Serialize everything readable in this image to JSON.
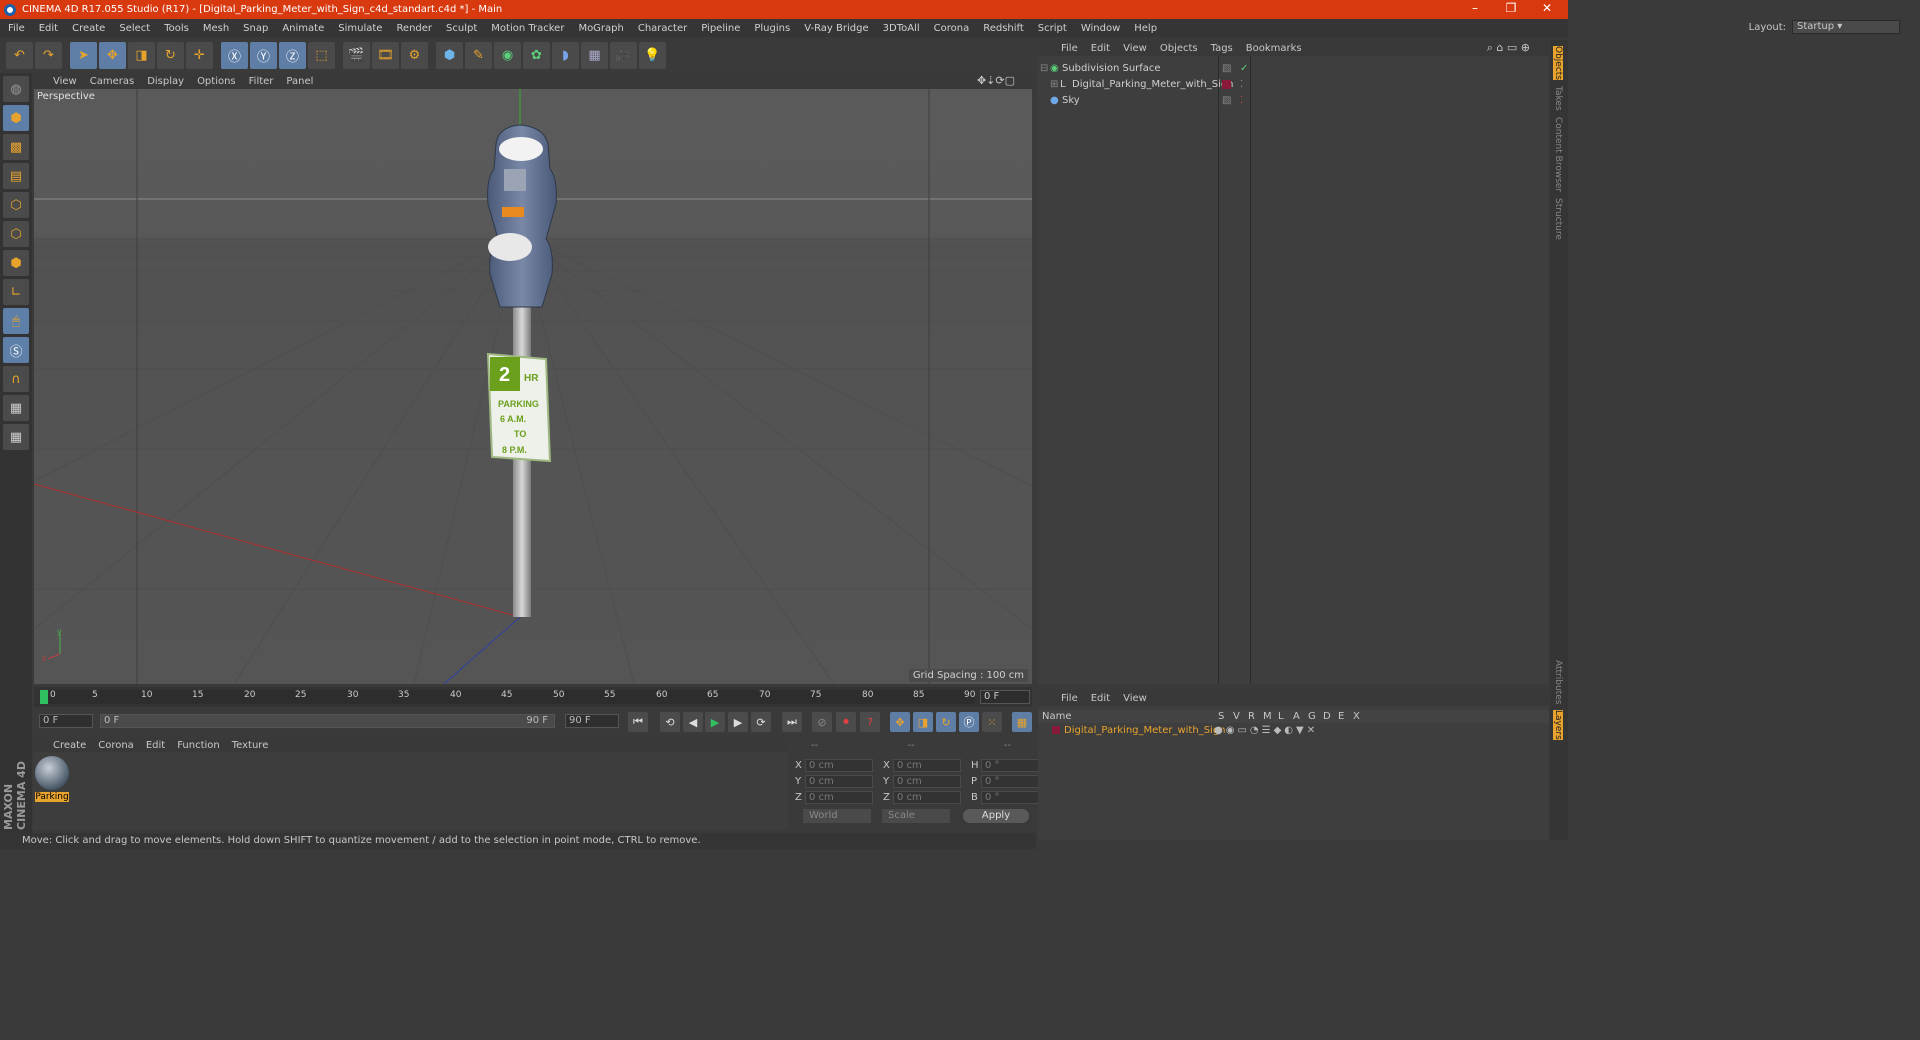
{
  "window": {
    "title": "CINEMA 4D R17.055 Studio (R17) - [Digital_Parking_Meter_with_Sign_c4d_standart.c4d *] - Main"
  },
  "menu": [
    "File",
    "Edit",
    "Create",
    "Select",
    "Tools",
    "Mesh",
    "Snap",
    "Animate",
    "Simulate",
    "Render",
    "Sculpt",
    "Motion Tracker",
    "MoGraph",
    "Character",
    "Pipeline",
    "Plugins",
    "V-Ray Bridge",
    "3DToAll",
    "Corona",
    "Redshift",
    "Script",
    "Window",
    "Help"
  ],
  "layout": {
    "label": "Layout:",
    "value": "Startup"
  },
  "viewport": {
    "menu": [
      "View",
      "Cameras",
      "Display",
      "Options",
      "Filter",
      "Panel"
    ],
    "label": "Perspective",
    "grid_spacing": "Grid Spacing : 100 cm",
    "sign": {
      "number": "2",
      "hr": "HR",
      "l1": "PARKING",
      "l2": "6 A.M.",
      "l3": "TO",
      "l4": "8 P.M."
    }
  },
  "timeline": {
    "ticks": [
      "0",
      "5",
      "10",
      "15",
      "20",
      "25",
      "30",
      "35",
      "40",
      "45",
      "50",
      "55",
      "60",
      "65",
      "70",
      "75",
      "80",
      "85",
      "90"
    ],
    "current": "0 F"
  },
  "playback": {
    "start": "0 F",
    "range_start": "0 F",
    "range_end": "90 F",
    "end": "90 F"
  },
  "materials": {
    "menu": [
      "Create",
      "Corona",
      "Edit",
      "Function",
      "Texture"
    ],
    "items": [
      {
        "name": "Parking"
      }
    ]
  },
  "coordinates": {
    "header": [
      "--",
      "--",
      "--"
    ],
    "rows": [
      {
        "a": "X",
        "av": "0 cm",
        "b": "X",
        "bv": "0 cm",
        "c": "H",
        "cv": "0 °"
      },
      {
        "a": "Y",
        "av": "0 cm",
        "b": "Y",
        "bv": "0 cm",
        "c": "P",
        "cv": "0 °"
      },
      {
        "a": "Z",
        "av": "0 cm",
        "b": "Z",
        "bv": "0 cm",
        "c": "B",
        "cv": "0 °"
      }
    ],
    "mode1": "World",
    "mode2": "Scale",
    "apply": "Apply"
  },
  "objects": {
    "menu": [
      "File",
      "Edit",
      "View",
      "Objects",
      "Tags",
      "Bookmarks"
    ],
    "items": [
      {
        "name": "Subdivision Surface"
      },
      {
        "name": "Digital_Parking_Meter_with_Sign"
      },
      {
        "name": "Sky"
      }
    ]
  },
  "attributes": {
    "menu": [
      "File",
      "Edit",
      "View"
    ],
    "name_col": "Name",
    "cols": [
      "S",
      "V",
      "R",
      "M",
      "L",
      "A",
      "G",
      "D",
      "E",
      "X"
    ],
    "row": "Digital_Parking_Meter_with_Sign"
  },
  "right_tabs": [
    "Objects",
    "Takes",
    "Content Browser",
    "Structure",
    "Attributes",
    "Layers"
  ],
  "status": "Move: Click and drag to move elements. Hold down SHIFT to quantize movement / add to the selection in point mode, CTRL to remove.",
  "brand": "MAXON CINEMA 4D",
  "colors": {
    "title_bar": "#d9390f",
    "accent": "#e8a32c",
    "selected_tool": "#5f7ea6"
  }
}
